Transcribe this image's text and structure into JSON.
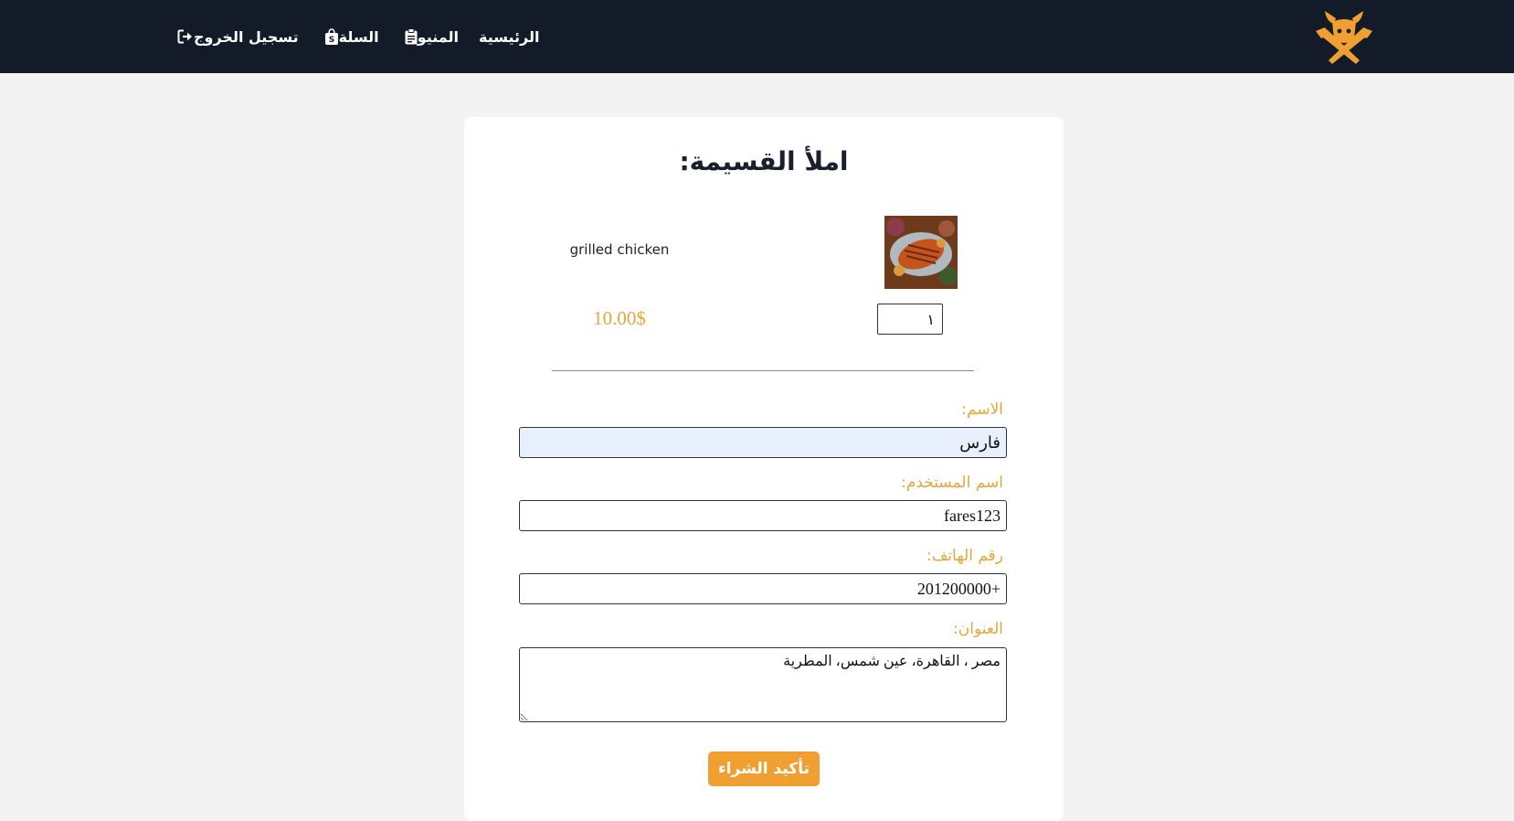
{
  "navbar": {
    "links": [
      {
        "label": "الرئيسية",
        "icon": ""
      },
      {
        "label": "المنيو",
        "icon": "clipboard-icon"
      },
      {
        "label": "السلة",
        "icon": "shopping-bag-icon"
      },
      {
        "label": "تسجيل الخروج",
        "icon": "logout-icon"
      }
    ],
    "logo_icon": "bull-knives-logo-icon"
  },
  "checkout": {
    "title": "املأ القسيمة:",
    "item": {
      "name": "grilled chicken",
      "quantity": "١",
      "price": "10.00$"
    },
    "fields": {
      "name": {
        "label": "الاسم:",
        "value": "فارس"
      },
      "username": {
        "label": "اسم المستخدم:",
        "value": "fares123"
      },
      "phone": {
        "label": "رقم الهاتف:",
        "value": "+201200000"
      },
      "address": {
        "label": "العنوان:",
        "value": "مصر ، القاهرة، عين شمس، المطرية"
      }
    },
    "submit_label": "تأكيد الشراء"
  },
  "colors": {
    "navbar_bg": "#131a28",
    "accent": "#f0a031",
    "page_bg": "#f3f3f3"
  }
}
